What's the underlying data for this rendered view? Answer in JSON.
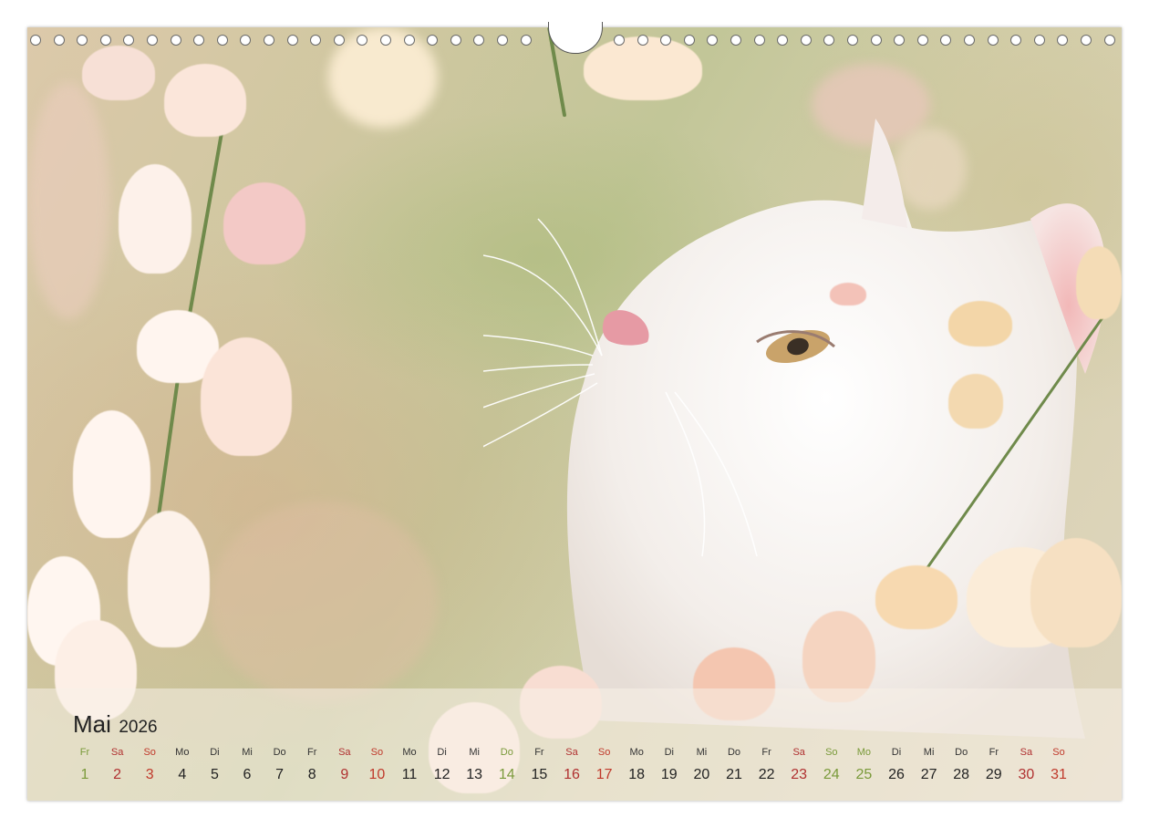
{
  "calendar": {
    "month": "Mai",
    "year": "2026",
    "days": [
      {
        "wd": "Fr",
        "d": "1",
        "t": "hol"
      },
      {
        "wd": "Sa",
        "d": "2",
        "t": "sat"
      },
      {
        "wd": "So",
        "d": "3",
        "t": "sun"
      },
      {
        "wd": "Mo",
        "d": "4",
        "t": ""
      },
      {
        "wd": "Di",
        "d": "5",
        "t": ""
      },
      {
        "wd": "Mi",
        "d": "6",
        "t": ""
      },
      {
        "wd": "Do",
        "d": "7",
        "t": ""
      },
      {
        "wd": "Fr",
        "d": "8",
        "t": ""
      },
      {
        "wd": "Sa",
        "d": "9",
        "t": "sat"
      },
      {
        "wd": "So",
        "d": "10",
        "t": "sun"
      },
      {
        "wd": "Mo",
        "d": "11",
        "t": ""
      },
      {
        "wd": "Di",
        "d": "12",
        "t": ""
      },
      {
        "wd": "Mi",
        "d": "13",
        "t": ""
      },
      {
        "wd": "Do",
        "d": "14",
        "t": "hol"
      },
      {
        "wd": "Fr",
        "d": "15",
        "t": ""
      },
      {
        "wd": "Sa",
        "d": "16",
        "t": "sat"
      },
      {
        "wd": "So",
        "d": "17",
        "t": "sun"
      },
      {
        "wd": "Mo",
        "d": "18",
        "t": ""
      },
      {
        "wd": "Di",
        "d": "19",
        "t": ""
      },
      {
        "wd": "Mi",
        "d": "20",
        "t": ""
      },
      {
        "wd": "Do",
        "d": "21",
        "t": ""
      },
      {
        "wd": "Fr",
        "d": "22",
        "t": ""
      },
      {
        "wd": "Sa",
        "d": "23",
        "t": "sat"
      },
      {
        "wd": "So",
        "d": "24",
        "t": "hol"
      },
      {
        "wd": "Mo",
        "d": "25",
        "t": "hol"
      },
      {
        "wd": "Di",
        "d": "26",
        "t": ""
      },
      {
        "wd": "Mi",
        "d": "27",
        "t": ""
      },
      {
        "wd": "Do",
        "d": "28",
        "t": ""
      },
      {
        "wd": "Fr",
        "d": "29",
        "t": ""
      },
      {
        "wd": "Sa",
        "d": "30",
        "t": "sat"
      },
      {
        "wd": "So",
        "d": "31",
        "t": "sun"
      }
    ]
  },
  "colors": {
    "saturday": "#b03030",
    "sunday": "#c0392b",
    "holiday": "#7a9a3a",
    "weekday": "#222222"
  }
}
